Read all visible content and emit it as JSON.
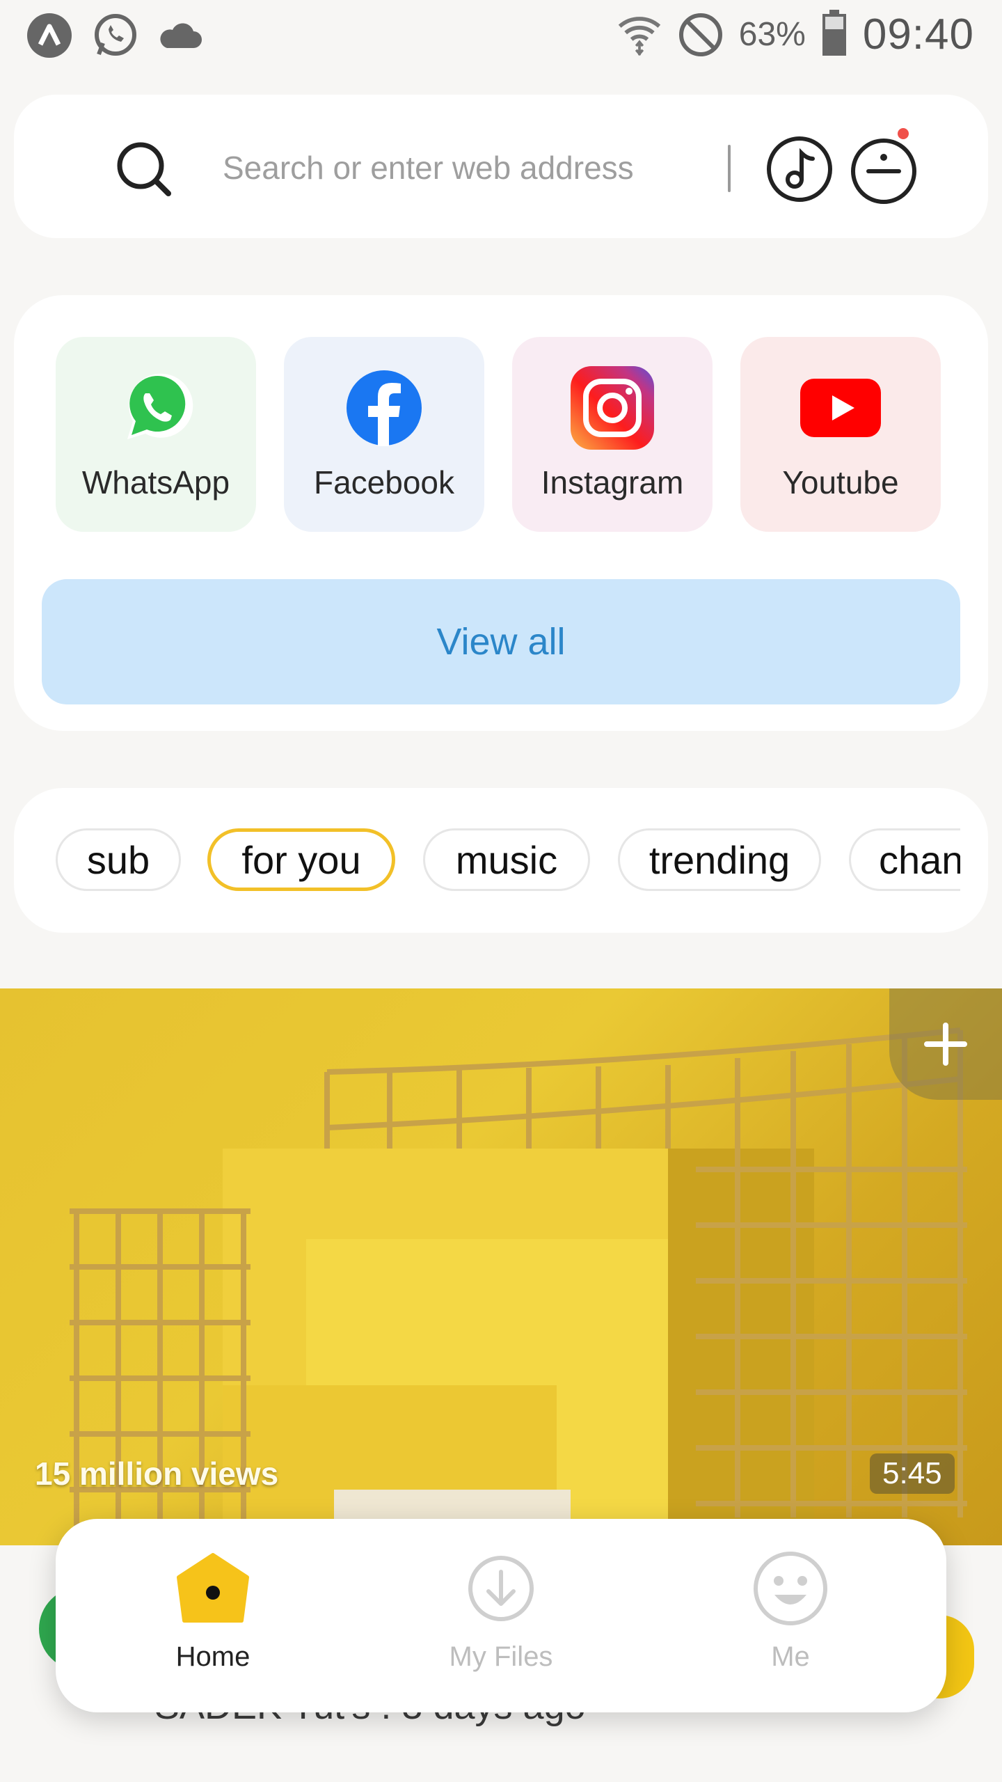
{
  "status_bar": {
    "battery": "63%",
    "time": "09:40",
    "left_icons": [
      "app-icon",
      "whatsapp-icon",
      "cloud-icon"
    ],
    "right_icons": [
      "wifi-icon",
      "do-not-disturb-icon",
      "battery-icon"
    ]
  },
  "search": {
    "placeholder": "Search or enter web address"
  },
  "shortcuts": [
    {
      "label": "WhatsApp",
      "icon": "whatsapp-logo",
      "bg": "#eef8ef"
    },
    {
      "label": "Facebook",
      "icon": "facebook-logo",
      "bg": "#edf2fa"
    },
    {
      "label": "Instagram",
      "icon": "instagram-logo",
      "bg": "#f9ecf3"
    },
    {
      "label": "Youtube",
      "icon": "youtube-logo",
      "bg": "#fbeaea"
    }
  ],
  "view_all_label": "View all",
  "categories": [
    {
      "label": "sub",
      "active": false
    },
    {
      "label": "for you",
      "active": true
    },
    {
      "label": "music",
      "active": false
    },
    {
      "label": "trending",
      "active": false
    },
    {
      "label": "chan",
      "active": false
    }
  ],
  "video": {
    "views": "15 million views",
    "duration": "5:45"
  },
  "behind_caption": "SADEK Tut's : 3 days ago",
  "bottom_nav": [
    {
      "label": "Home",
      "icon": "home-icon",
      "active": true
    },
    {
      "label": "My Files",
      "icon": "download-icon",
      "active": false
    },
    {
      "label": "Me",
      "icon": "smiley-icon",
      "active": false
    }
  ],
  "colors": {
    "accent": "#f2c028",
    "link_blue": "#2b86c9",
    "view_all_bg": "#cce6fb"
  }
}
